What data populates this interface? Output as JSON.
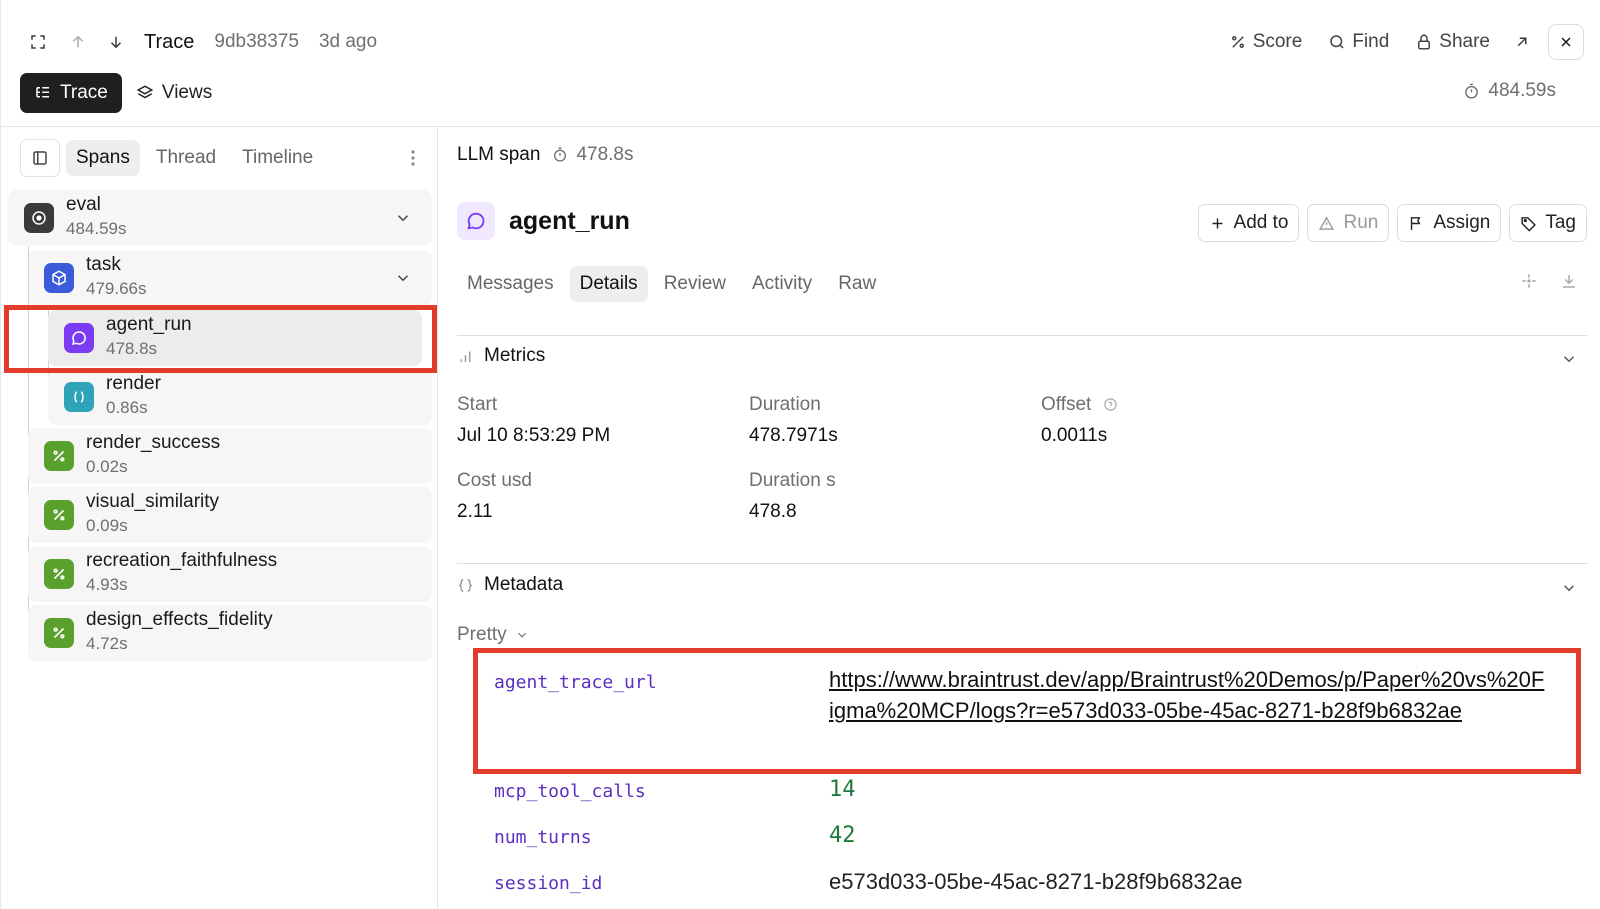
{
  "header": {
    "title": "Trace",
    "trace_id": "9db38375",
    "age": "3d ago",
    "actions": {
      "score": "Score",
      "find": "Find",
      "share": "Share"
    },
    "view_button": "Trace",
    "views_button": "Views",
    "total_duration": "484.59s"
  },
  "left_panel": {
    "tabs": [
      "Spans",
      "Thread",
      "Timeline"
    ],
    "active_tab": "Spans",
    "spans": [
      {
        "name": "eval",
        "duration": "484.59s",
        "icon": "target-icon",
        "color": "#3a3a3a"
      },
      {
        "name": "task",
        "duration": "479.66s",
        "icon": "box-icon",
        "color": "#3b5bdb"
      },
      {
        "name": "agent_run",
        "duration": "478.8s",
        "icon": "chat-bubble-icon",
        "color": "#7a3bf2"
      },
      {
        "name": "render",
        "duration": "0.86s",
        "icon": "parens-icon",
        "color": "#2fa4b8"
      },
      {
        "name": "render_success",
        "duration": "0.02s",
        "icon": "percent-icon",
        "color": "#5aa02c"
      },
      {
        "name": "visual_similarity",
        "duration": "0.09s",
        "icon": "percent-icon",
        "color": "#5aa02c"
      },
      {
        "name": "recreation_faithfulness",
        "duration": "4.93s",
        "icon": "percent-icon",
        "color": "#5aa02c"
      },
      {
        "name": "design_effects_fidelity",
        "duration": "4.72s",
        "icon": "percent-icon",
        "color": "#5aa02c"
      }
    ]
  },
  "detail": {
    "span_type": "LLM span",
    "span_duration": "478.8s",
    "title": "agent_run",
    "actions": {
      "add_to": "Add to",
      "run": "Run",
      "assign": "Assign",
      "tag": "Tag"
    },
    "tabs": [
      "Messages",
      "Details",
      "Review",
      "Activity",
      "Raw"
    ],
    "active_tab": "Details",
    "metrics": {
      "heading": "Metrics",
      "start_label": "Start",
      "start_value": "Jul 10 8:53:29 PM",
      "duration_label": "Duration",
      "duration_value": "478.7971s",
      "offset_label": "Offset",
      "offset_value": "0.0011s",
      "cost_label": "Cost usd",
      "cost_value": "2.11",
      "duration_s_label": "Duration s",
      "duration_s_value": "478.8"
    },
    "metadata": {
      "heading": "Metadata",
      "format": "Pretty",
      "agent_trace_url_key": "agent_trace_url",
      "agent_trace_url": "https://www.braintrust.dev/app/Braintrust%20Demos/p/Paper%20vs%20Figma%20MCP/logs?r=e573d033-05be-45ac-8271-b28f9b6832ae",
      "mcp_tool_calls_key": "mcp_tool_calls",
      "mcp_tool_calls": "14",
      "num_turns_key": "num_turns",
      "num_turns": "42",
      "session_id_key": "session_id",
      "session_id": "e573d033-05be-45ac-8271-b28f9b6832ae"
    }
  },
  "colors": {
    "highlight": "#e33b2b",
    "key_purple": "#5b2fbf",
    "number_green": "#1e7a3a"
  }
}
